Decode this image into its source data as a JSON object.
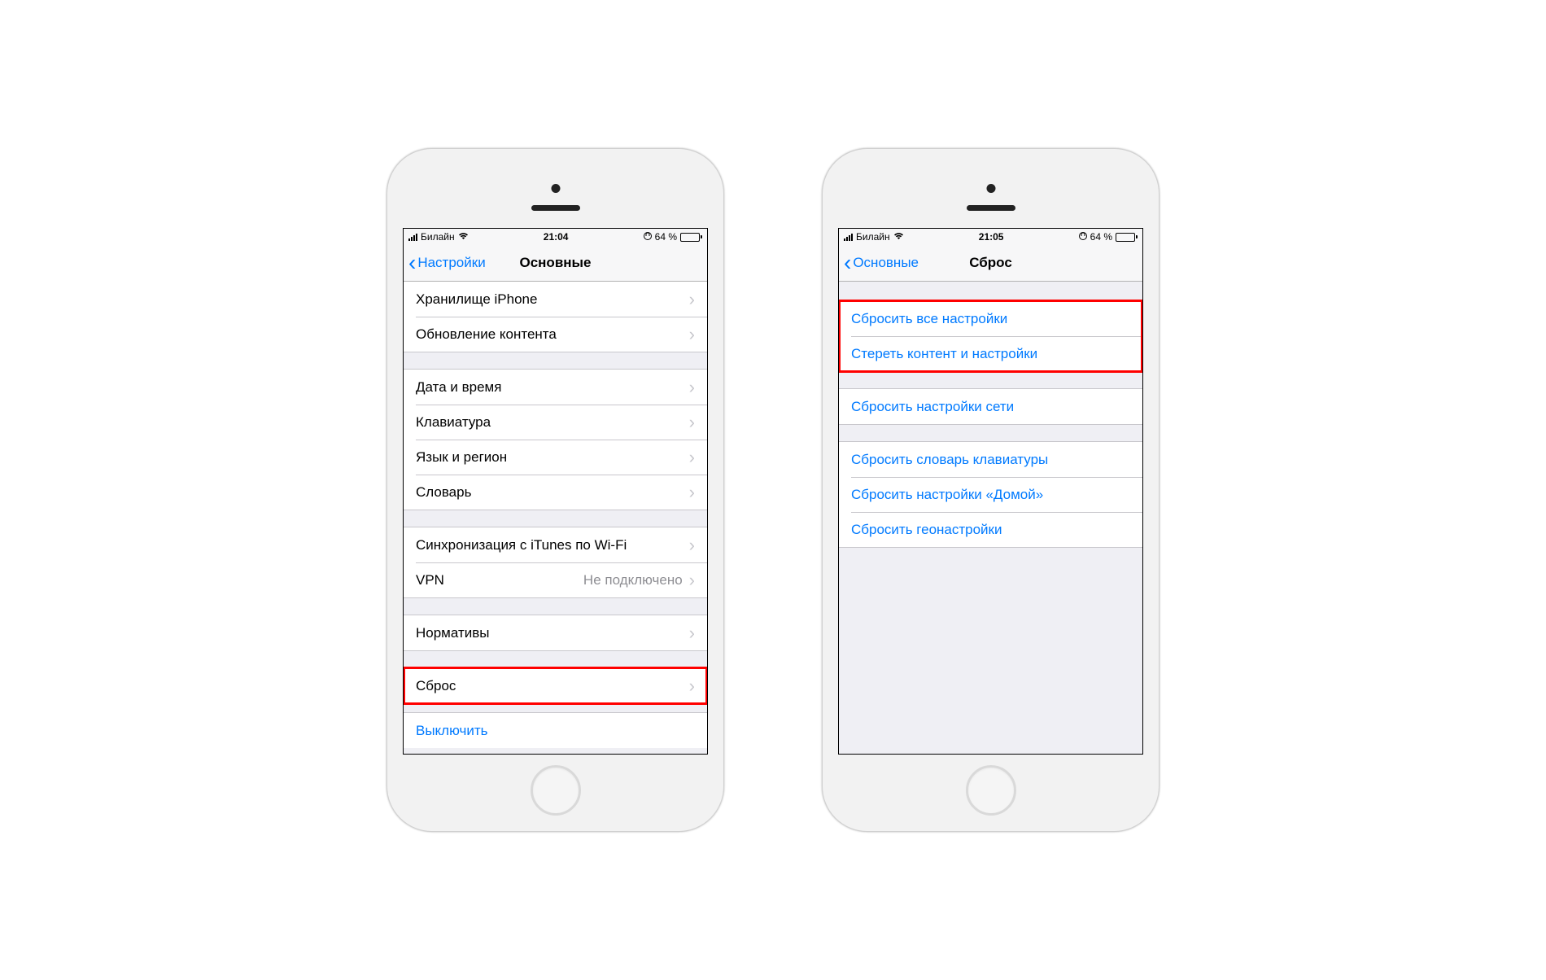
{
  "status": {
    "carrier": "Билайн",
    "time_left": "21:04",
    "time_right": "21:05",
    "battery_text": "64 %"
  },
  "left": {
    "back_label": "Настройки",
    "title": "Основные",
    "rows": {
      "storage": "Хранилище iPhone",
      "refresh": "Обновление контента",
      "datetime": "Дата и время",
      "keyboard": "Клавиатура",
      "language": "Язык и регион",
      "dictionary": "Словарь",
      "itunes": "Синхронизация с iTunes по Wi-Fi",
      "vpn": "VPN",
      "vpn_value": "Не подключено",
      "regulatory": "Нормативы",
      "reset": "Сброс",
      "shutdown": "Выключить"
    }
  },
  "right": {
    "back_label": "Основные",
    "title": "Сброс",
    "rows": {
      "reset_all": "Сбросить все настройки",
      "erase_all": "Стереть контент и настройки",
      "reset_network": "Сбросить настройки сети",
      "reset_keyboard": "Сбросить словарь клавиатуры",
      "reset_home": "Сбросить настройки «Домой»",
      "reset_location": "Сбросить геонастройки"
    }
  }
}
